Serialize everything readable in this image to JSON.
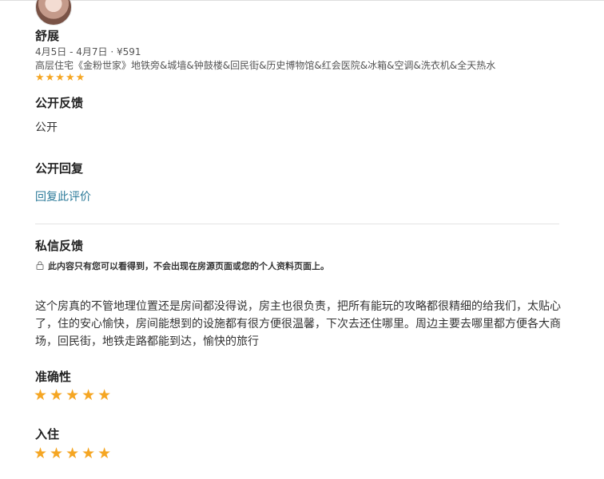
{
  "reviewer": {
    "name": "舒展",
    "meta": "4月5日 - 4月7日 · ¥591",
    "listing": "高层住宅《金粉世家》地铁旁&城墙&钟鼓楼&回民街&历史博物馆&红会医院&冰箱&空调&洗衣机&全天热水",
    "stars": "★★★★★"
  },
  "public_feedback": {
    "title": "公开反馈",
    "value": "公开"
  },
  "public_reply": {
    "title": "公开回复",
    "link": "回复此评价"
  },
  "private_feedback": {
    "title": "私信反馈",
    "note": "此内容只有您可以看得到，不会出现在房源页面或您的个人资料页面上。",
    "text": "这个房真的不管地理位置还是房间都没得说，房主也很负责，把所有能玩的攻略都很精细的给我们，太贴心了，住的安心愉快，房间能想到的设施都有很方便很温馨，下次去还住哪里。周边主要去哪里都方便各大商场，回民街，地铁走路都能到达，愉快的旅行"
  },
  "ratings": [
    {
      "label": "准确性",
      "stars": "★★★★★",
      "value": 5,
      "max": 5
    },
    {
      "label": "入住",
      "stars": "★★★★★",
      "value": 5,
      "max": 5
    }
  ],
  "colors": {
    "star": "#f5a623",
    "link": "#2b7a99"
  }
}
